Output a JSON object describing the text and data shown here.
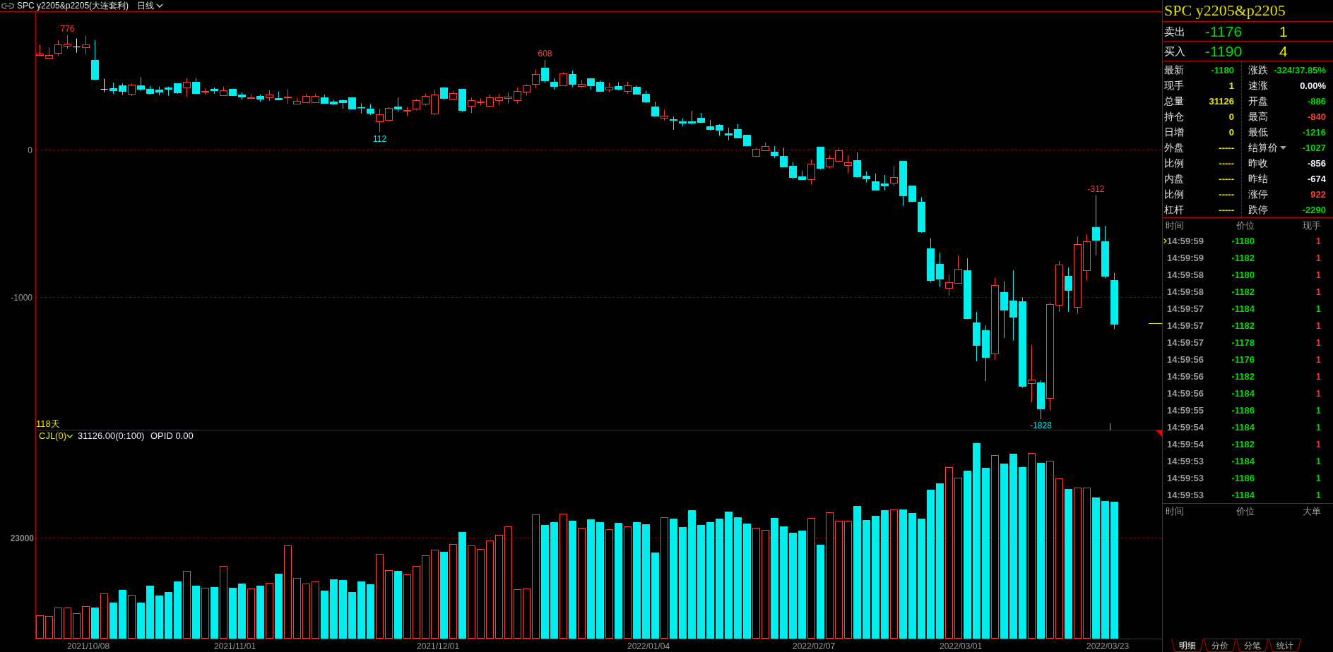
{
  "header": {
    "title": "SPC y2205&p2205(大连套利)",
    "period": "日线"
  },
  "price_chart": {
    "y_axis_labels": [
      "0",
      "-1000"
    ],
    "annotations": [
      {
        "text": "776",
        "kind": "high"
      },
      {
        "text": "608",
        "kind": "high"
      },
      {
        "text": "112",
        "kind": "low"
      },
      {
        "text": "-312",
        "kind": "high"
      },
      {
        "text": "-1828",
        "kind": "low"
      }
    ],
    "bar_count": "118天"
  },
  "volume_chart": {
    "indicator": "CJL(0)",
    "value": "31126.00(0:100)",
    "extra": "OPID 0.00",
    "y_axis_labels": [
      "23000"
    ]
  },
  "x_axis_labels": [
    "2021/10/08",
    "2021/11/01",
    "2021/12/01",
    "2022/01/04",
    "2022/02/07",
    "2022/03/01",
    "2022/03/23"
  ],
  "quote": {
    "title": "SPC y2205&p2205",
    "ask": {
      "label": "卖出",
      "price": "-1176",
      "volume": "1"
    },
    "bid": {
      "label": "买入",
      "price": "-1190",
      "volume": "4"
    }
  },
  "stats": {
    "left": [
      {
        "label": "最新",
        "value": "-1180",
        "color": "#00dc00"
      },
      {
        "label": "现手",
        "value": "1",
        "color": "#e6e600"
      },
      {
        "label": "总量",
        "value": "31126",
        "color": "#e6e600"
      },
      {
        "label": "持仓",
        "value": "0",
        "color": "#e6e600"
      },
      {
        "label": "日增",
        "value": "0",
        "color": "#e6e600"
      },
      {
        "label": "外盘",
        "value": "-----",
        "color": "#e6e600"
      },
      {
        "label": "比例",
        "value": "-----",
        "color": "#e6e600"
      },
      {
        "label": "内盘",
        "value": "-----",
        "color": "#e6e600"
      },
      {
        "label": "比例",
        "value": "-----",
        "color": "#e6e600"
      },
      {
        "label": "杠杆",
        "value": "-----",
        "color": "#e6e600"
      }
    ],
    "right": [
      {
        "label": "涨跌",
        "value": "-324/37.85%",
        "color": "#00dc00",
        "dropdown": false
      },
      {
        "label": "速涨",
        "value": "0.00%",
        "color": "#f0f0ff",
        "dropdown": false
      },
      {
        "label": "开盘",
        "value": "-886",
        "color": "#00dc00",
        "dropdown": false
      },
      {
        "label": "最高",
        "value": "-840",
        "color": "#ff3c3c",
        "dropdown": false
      },
      {
        "label": "最低",
        "value": "-1216",
        "color": "#00dc00",
        "dropdown": false
      },
      {
        "label": "结算价",
        "value": "-1027",
        "color": "#00dc00",
        "dropdown": true
      },
      {
        "label": "昨收",
        "value": "-856",
        "color": "#f0f0ff",
        "dropdown": false
      },
      {
        "label": "昨结",
        "value": "-674",
        "color": "#f0f0ff",
        "dropdown": false
      },
      {
        "label": "涨停",
        "value": "922",
        "color": "#ff3c3c",
        "dropdown": false
      },
      {
        "label": "跌停",
        "value": "-2290",
        "color": "#00dc00",
        "dropdown": false
      }
    ]
  },
  "ticks": {
    "columns": [
      "时间",
      "价位",
      "现手"
    ],
    "rows": [
      {
        "time": "14:59:59",
        "price": "-1180",
        "volume": "1",
        "color": "#ff3232",
        "selected": true
      },
      {
        "time": "14:59:59",
        "price": "-1182",
        "volume": "1",
        "color": "#ff3232",
        "selected": false
      },
      {
        "time": "14:59:58",
        "price": "-1180",
        "volume": "1",
        "color": "#ff3232",
        "selected": false
      },
      {
        "time": "14:59:58",
        "price": "-1182",
        "volume": "1",
        "color": "#ff3232",
        "selected": false
      },
      {
        "time": "14:59:57",
        "price": "-1184",
        "volume": "1",
        "color": "#00dc00",
        "selected": false
      },
      {
        "time": "14:59:57",
        "price": "-1182",
        "volume": "1",
        "color": "#ff3232",
        "selected": false
      },
      {
        "time": "14:59:57",
        "price": "-1178",
        "volume": "1",
        "color": "#ff3232",
        "selected": false
      },
      {
        "time": "14:59:56",
        "price": "-1176",
        "volume": "1",
        "color": "#ff3232",
        "selected": false
      },
      {
        "time": "14:59:56",
        "price": "-1182",
        "volume": "1",
        "color": "#ff3232",
        "selected": false
      },
      {
        "time": "14:59:56",
        "price": "-1184",
        "volume": "1",
        "color": "#ff3232",
        "selected": false
      },
      {
        "time": "14:59:55",
        "price": "-1186",
        "volume": "1",
        "color": "#00dc00",
        "selected": false
      },
      {
        "time": "14:59:54",
        "price": "-1184",
        "volume": "1",
        "color": "#00dc00",
        "selected": false
      },
      {
        "time": "14:59:54",
        "price": "-1182",
        "volume": "1",
        "color": "#ff3232",
        "selected": false
      },
      {
        "time": "14:59:53",
        "price": "-1184",
        "volume": "1",
        "color": "#00dc00",
        "selected": false
      },
      {
        "time": "14:59:53",
        "price": "-1186",
        "volume": "1",
        "color": "#00dc00",
        "selected": false
      },
      {
        "time": "14:59:53",
        "price": "-1184",
        "volume": "1",
        "color": "#00dc00",
        "selected": false
      }
    ]
  },
  "big_orders": {
    "columns": [
      "时间",
      "价位",
      "大单"
    ]
  },
  "tabs": [
    {
      "label": "明细",
      "selected": true
    },
    {
      "label": "分价",
      "selected": false
    },
    {
      "label": "分笔",
      "selected": false
    },
    {
      "label": "统计",
      "selected": false
    }
  ]
}
